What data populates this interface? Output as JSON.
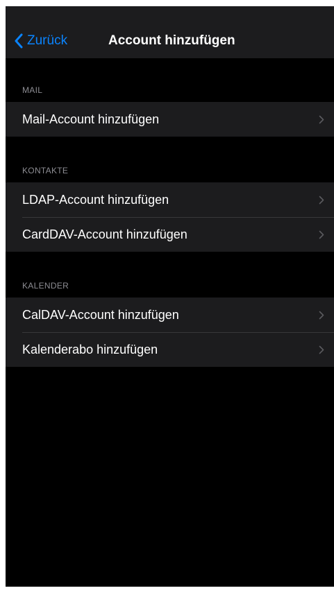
{
  "nav": {
    "back_label": "Zurück",
    "title": "Account hinzufügen",
    "back_icon": "chevron-left-icon"
  },
  "sections": [
    {
      "header": "MAIL",
      "rows": [
        {
          "label": "Mail-Account hinzufügen",
          "icon": "chevron-right-icon"
        }
      ]
    },
    {
      "header": "KONTAKTE",
      "rows": [
        {
          "label": "LDAP-Account hinzufügen",
          "icon": "chevron-right-icon"
        },
        {
          "label": "CardDAV-Account hinzufügen",
          "icon": "chevron-right-icon"
        }
      ]
    },
    {
      "header": "KALENDER",
      "rows": [
        {
          "label": "CalDAV-Account hinzufügen",
          "icon": "chevron-right-icon"
        },
        {
          "label": "Kalenderabo hinzufügen",
          "icon": "chevron-right-icon"
        }
      ]
    }
  ],
  "colors": {
    "accent": "#0a84ff",
    "background": "#000000",
    "cell_background": "#1c1c1e",
    "separator": "#38383a",
    "secondary_text": "#8d8d93",
    "chevron": "#5a5a5e"
  }
}
